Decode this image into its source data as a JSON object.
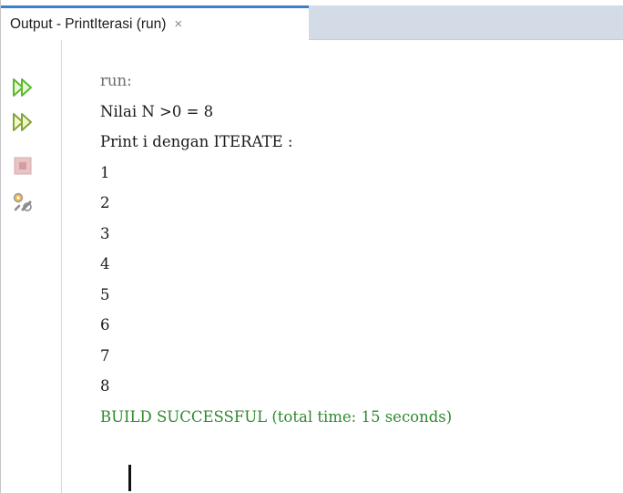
{
  "tab": {
    "title": "Output - PrintIterasi (run)",
    "close_glyph": "×"
  },
  "toolbar": {
    "buttons": [
      {
        "icon": "rerun-icon",
        "tooltip": ""
      },
      {
        "icon": "rerun-with-options-icon",
        "tooltip": ""
      },
      {
        "icon": "stop-icon",
        "tooltip": ""
      },
      {
        "icon": "settings-icon",
        "tooltip": ""
      }
    ]
  },
  "console": {
    "lines": [
      "run:",
      "Nilai N >0 = 8",
      "Print i dengan ITERATE :",
      "1",
      "2",
      "3",
      "4",
      "5",
      "6",
      "7",
      "8",
      "BUILD SUCCESSFUL (total time: 15 seconds)"
    ]
  },
  "colors": {
    "accent": "#3a7fd6",
    "success": "#2f8a2f",
    "run_icon": "#5cb82f"
  }
}
